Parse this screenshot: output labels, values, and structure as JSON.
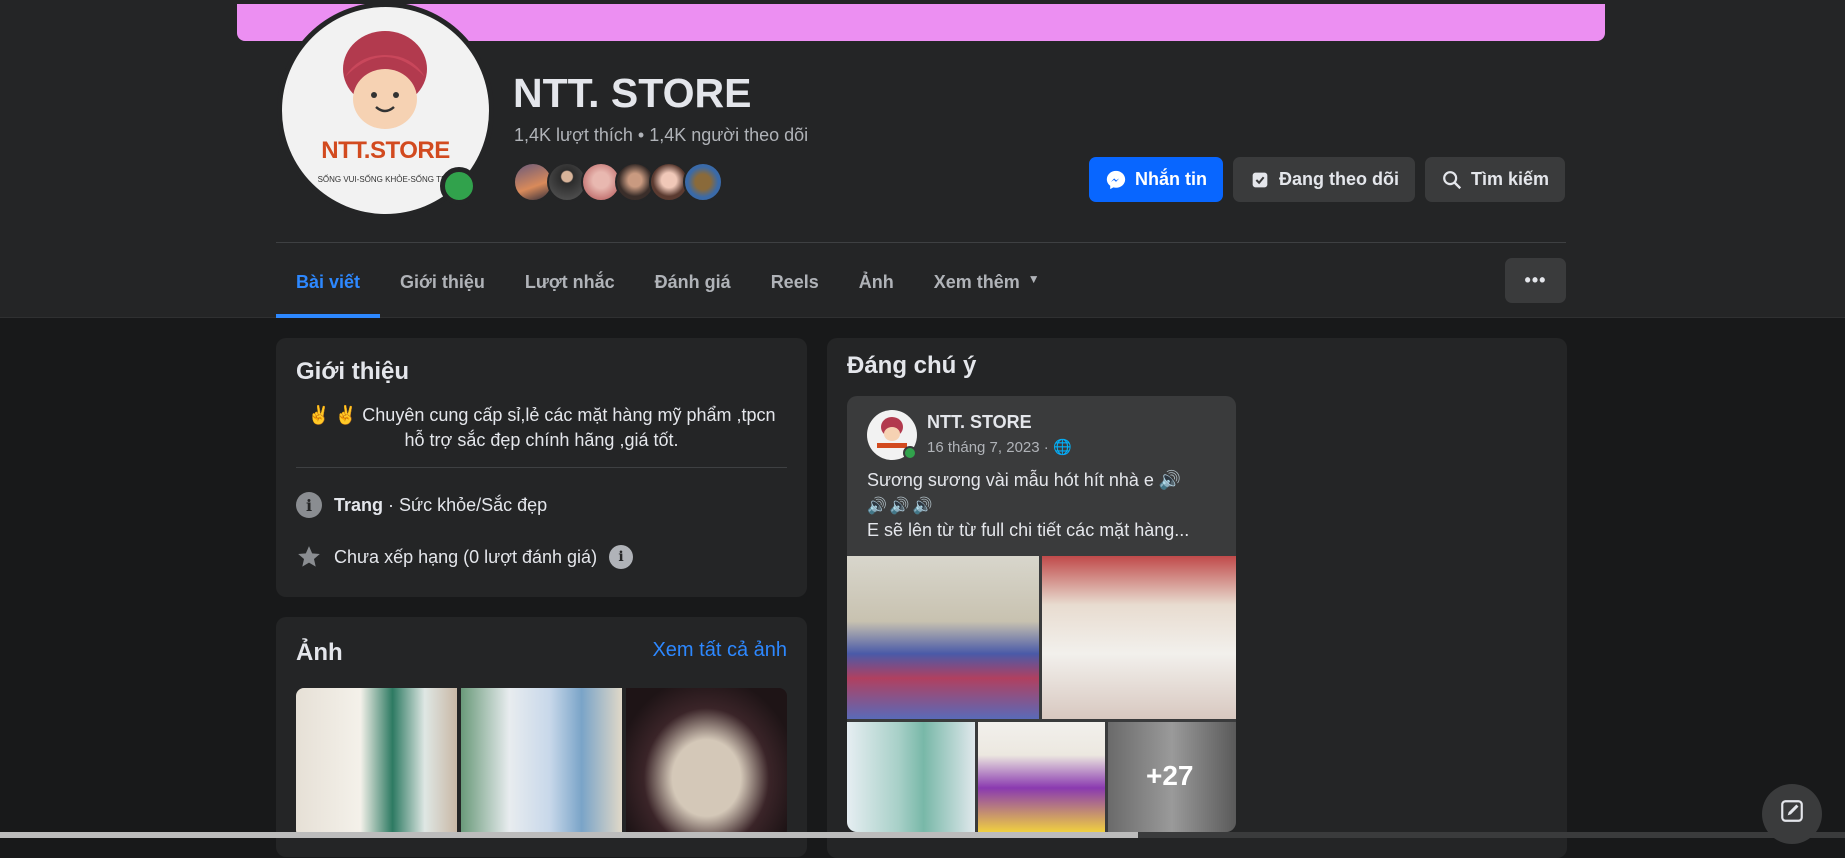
{
  "profile": {
    "name": "NTT. STORE",
    "stats": "1,4K lượt thích • 1,4K người theo dõi",
    "avatar_logo_text": "NTT.STORE",
    "avatar_tagline": "SỐNG VUI-SỐNG KHỎE-SỐNG TR..."
  },
  "actions": {
    "message": "Nhắn tin",
    "following": "Đang theo dõi",
    "search": "Tìm kiếm"
  },
  "tabs": [
    {
      "label": "Bài viết"
    },
    {
      "label": "Giới thiệu"
    },
    {
      "label": "Lượt nhắc"
    },
    {
      "label": "Đánh giá"
    },
    {
      "label": "Reels"
    },
    {
      "label": "Ảnh"
    },
    {
      "label": "Xem thêm"
    }
  ],
  "more_label": "•••",
  "intro": {
    "title": "Giới thiệu",
    "bio": "✌️ ✌️ Chuyên cung cấp sỉ,lẻ các mặt hàng mỹ phẩm ,tpcn hỗ trợ sắc đẹp chính hãng ,giá tốt.",
    "page_type_bold": "Trang",
    "page_type_rest": " · Sức khỏe/Sắc đẹp",
    "rating": "Chưa xếp hạng (0 lượt đánh giá)"
  },
  "photos": {
    "title": "Ảnh",
    "see_all": "Xem tất cả ảnh"
  },
  "featured": {
    "title": "Đáng chú ý",
    "post": {
      "author": "NTT. STORE",
      "date": "16 tháng 7, 2023 · ",
      "line1": "Sương sương vài mẫu hót hít nhà e 🔊",
      "line2": "🔊🔊🔊",
      "line3": "E sẽ lên từ từ full chi tiết các mặt hàng...",
      "more_count": "+27"
    }
  },
  "colors": {
    "accent": "#0866ff",
    "link": "#2d88ff",
    "cover": "#ec8ff2",
    "online": "#31a24c"
  }
}
